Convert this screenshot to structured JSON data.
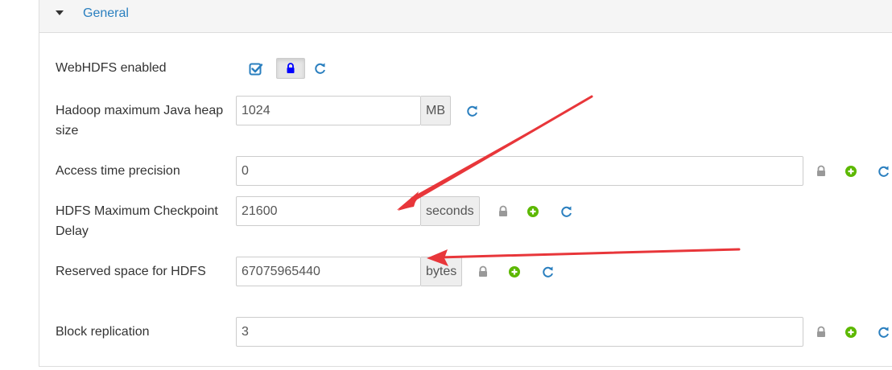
{
  "section": {
    "title": "General"
  },
  "rows": [
    {
      "label": "WebHDFS enabled",
      "checked": true
    },
    {
      "label": "Hadoop maximum Java heap size",
      "value": "1024",
      "unit": "MB"
    },
    {
      "label": "Access time precision",
      "value": "0"
    },
    {
      "label": "HDFS Maximum Checkpoint Delay",
      "value": "21600",
      "unit": "seconds"
    },
    {
      "label": "Reserved space for HDFS",
      "value": "67075965440",
      "unit": "bytes"
    },
    {
      "label": "Block replication",
      "value": "3"
    }
  ],
  "icons": {
    "lock": "lock-icon",
    "override": "plus-circle-icon",
    "reset": "refresh-icon",
    "checkbox": "checkbox-checked-icon"
  },
  "colors": {
    "link": "#2a7fbf",
    "override_green": "#5cb800",
    "lock_gray": "#999999",
    "lock_blue": "#0000ff",
    "annotation_arrow": "#e8363a"
  }
}
